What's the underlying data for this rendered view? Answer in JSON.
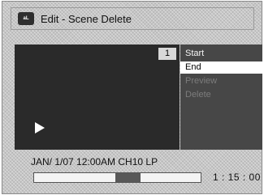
{
  "title_bar": {
    "icon_label": "aL",
    "title": "Edit - Scene Delete"
  },
  "preview": {
    "scene_number": "1",
    "playback_icon": "play-icon"
  },
  "menu": {
    "items": [
      {
        "label": "Start",
        "state": "normal"
      },
      {
        "label": "End",
        "state": "selected"
      },
      {
        "label": "Preview",
        "state": "disabled"
      },
      {
        "label": "Delete",
        "state": "disabled"
      }
    ]
  },
  "status": {
    "recording_info": "JAN/ 1/07 12:00AM CH10   LP"
  },
  "progress": {
    "marker_start_fraction": 0.49,
    "marker_end_fraction": 0.64,
    "time": "1 : 15 : 00"
  },
  "colors": {
    "menu_background": "#474747",
    "selected_item_background": "#ffffff",
    "preview_background": "#2a2a2a"
  }
}
